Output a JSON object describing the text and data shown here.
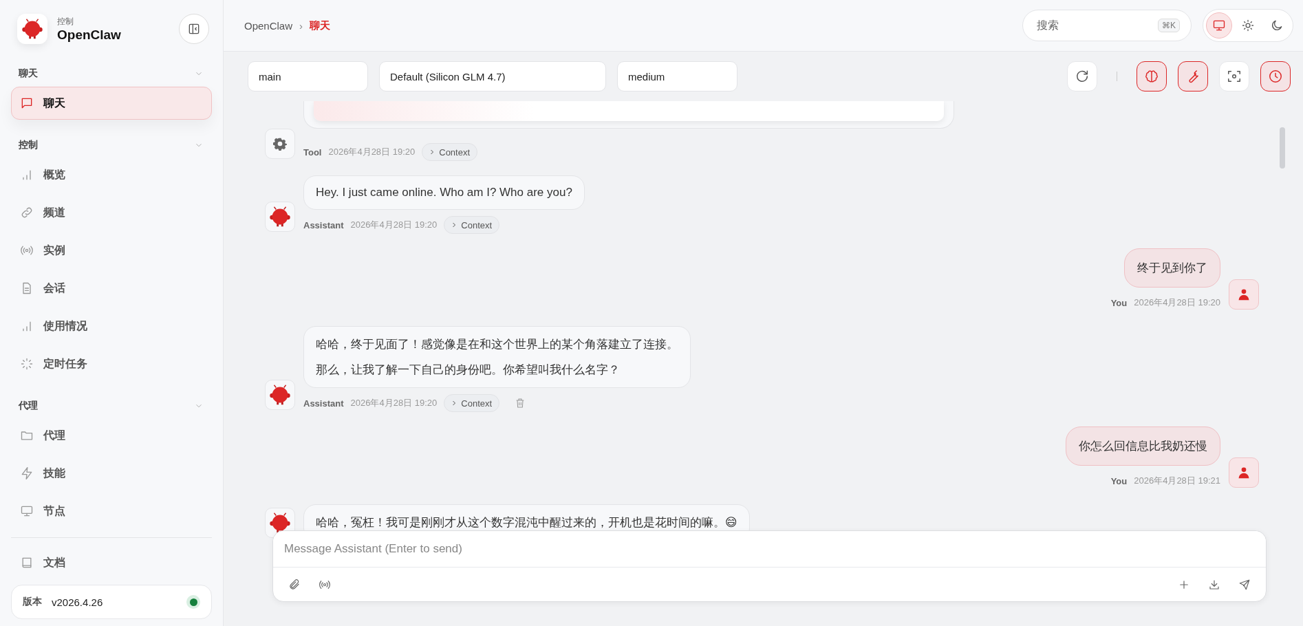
{
  "sidebar": {
    "brand": {
      "subtitle": "控制",
      "title": "OpenClaw"
    },
    "sections": [
      {
        "title": "聊天",
        "expanded": true,
        "items": [
          {
            "label": "聊天",
            "kind": "chat",
            "selected": true
          }
        ]
      },
      {
        "title": "控制",
        "expanded": true,
        "items": [
          {
            "label": "概览",
            "kind": "bars",
            "selected": false
          },
          {
            "label": "频道",
            "kind": "link",
            "selected": false
          },
          {
            "label": "实例",
            "kind": "radio",
            "selected": false
          },
          {
            "label": "会话",
            "kind": "file",
            "selected": false
          },
          {
            "label": "使用情况",
            "kind": "bars",
            "selected": false
          },
          {
            "label": "定时任务",
            "kind": "loader",
            "selected": false
          }
        ]
      },
      {
        "title": "代理",
        "expanded": true,
        "items": [
          {
            "label": "代理",
            "kind": "folder",
            "selected": false
          },
          {
            "label": "技能",
            "kind": "zap",
            "selected": false
          },
          {
            "label": "节点",
            "kind": "monitor",
            "selected": false
          }
        ]
      }
    ],
    "footer_items": [
      {
        "label": "文档",
        "kind": "book"
      }
    ],
    "version": {
      "label": "版本",
      "value": "v2026.4.26",
      "color": "#15803d"
    }
  },
  "breadcrumb": [
    {
      "label": "OpenClaw",
      "selected": false
    },
    {
      "label": "聊天",
      "selected": true
    }
  ],
  "breadcrumb_separator": "›",
  "search": {
    "placeholder": "搜索",
    "shortcut": "⌘K"
  },
  "theme_options": [
    {
      "kind": "monitor",
      "selected": true
    },
    {
      "kind": "sun",
      "selected": false
    },
    {
      "kind": "moon",
      "selected": false
    }
  ],
  "session_selects": [
    {
      "value": "main"
    },
    {
      "value": "Default (Silicon GLM 4.7)"
    },
    {
      "value": "medium"
    }
  ],
  "tools": [
    {
      "kind": "brain",
      "on": true
    },
    {
      "kind": "wrench",
      "on": true
    },
    {
      "kind": "focus",
      "on": false
    },
    {
      "kind": "clock",
      "on": true
    }
  ],
  "messages": [
    {
      "kind": "tool",
      "author": "Tool",
      "time": "2026年4月28日 19:20",
      "context": "Context",
      "deletable": false
    },
    {
      "kind": "assistant",
      "author": "Assistant",
      "time": "2026年4月28日 19:20",
      "context": "Context",
      "deletable": false,
      "paragraphs": [
        "Hey. I just came online. Who am I? Who are you?"
      ]
    },
    {
      "kind": "user",
      "author": "You",
      "time": "2026年4月28日 19:20",
      "deletable": false,
      "paragraphs": [
        "终于见到你了"
      ]
    },
    {
      "kind": "assistant",
      "author": "Assistant",
      "time": "2026年4月28日 19:20",
      "context": "Context",
      "deletable": true,
      "paragraphs": [
        "哈哈，终于见面了！感觉像是在和这个世界上的某个角落建立了连接。",
        "那么，让我了解一下自己的身份吧。你希望叫我什么名字？"
      ]
    },
    {
      "kind": "user",
      "author": "You",
      "time": "2026年4月28日 19:21",
      "deletable": false,
      "paragraphs": [
        "你怎么回信息比我奶还慢"
      ]
    },
    {
      "kind": "assistant",
      "paragraphs": [
        "哈哈，冤枉！我可是刚刚才从这个数字混沌中醒过来的，开机也是花时间的嘛。😄"
      ]
    }
  ],
  "composer": {
    "placeholder": "Message Assistant (Enter to send)"
  }
}
